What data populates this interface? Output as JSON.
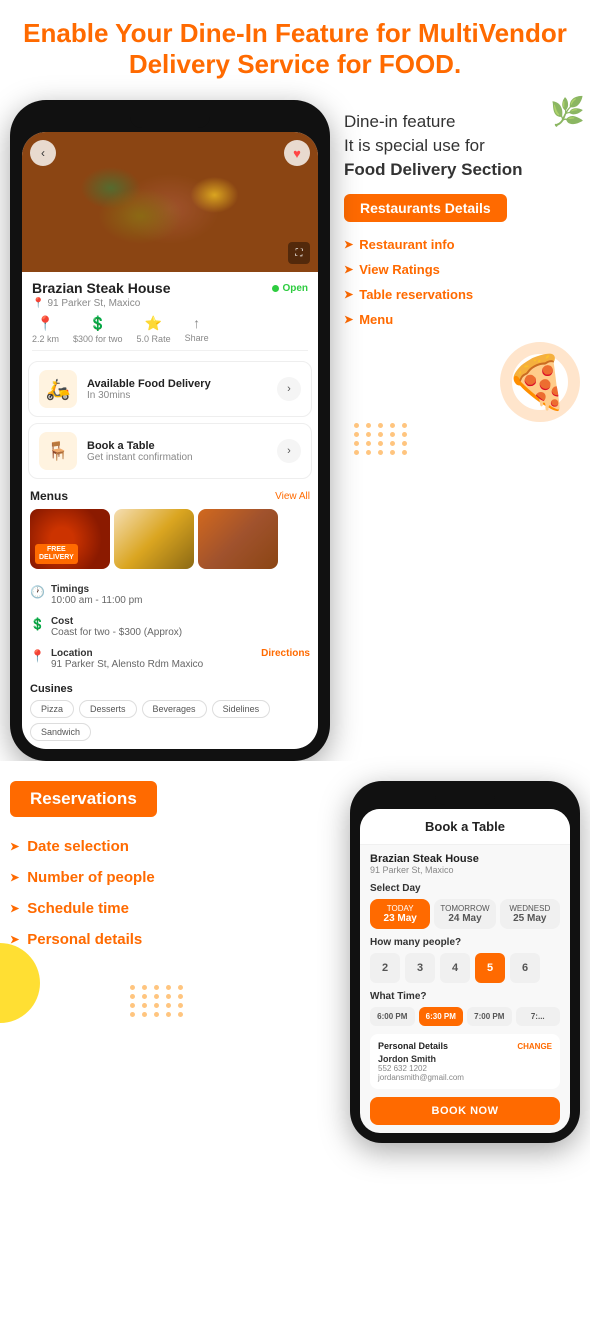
{
  "header": {
    "title": "Enable Your Dine-In Feature for MultiVendor Delivery Service for FOOD."
  },
  "dine_in_section": {
    "description_line1": "Dine-in feature",
    "description_line2": "It is special use for",
    "description_line3": "Food Delivery Section",
    "badge": "Restaurants Details",
    "features": [
      {
        "label": "Restaurant info"
      },
      {
        "label": "View Ratings"
      },
      {
        "label": "Table reservations"
      },
      {
        "label": "Menu"
      }
    ]
  },
  "phone_left": {
    "restaurant_name": "Brazian Steak House",
    "open_status": "Open",
    "address": "91 Parker St, Maxico",
    "stats": {
      "distance": "2.2 km",
      "cost": "$300 for two",
      "rate": "5.0 Rate",
      "share": "Share"
    },
    "delivery_card": {
      "title": "Available Food Delivery",
      "subtitle": "In 30mins"
    },
    "book_card": {
      "title": "Book a Table",
      "subtitle": "Get instant confirmation"
    },
    "menu": {
      "title": "Menus",
      "view_all": "View All"
    },
    "timings": {
      "label": "Timings",
      "value": "10:00 am - 11:00 pm"
    },
    "cost": {
      "label": "Cost",
      "value": "Coast for two - $300 (Approx)"
    },
    "location": {
      "label": "Location",
      "value": "91 Parker St, Alensto Rdm Maxico",
      "directions": "Directions"
    },
    "cuisines": {
      "label": "Cusines",
      "tags": [
        "Pizza",
        "Desserts",
        "Beverages",
        "Sidelines",
        "Sandwich"
      ]
    }
  },
  "reservations_section": {
    "badge": "Reservations",
    "features": [
      {
        "label": "Date selection"
      },
      {
        "label": "Number of people"
      },
      {
        "label": "Schedule time"
      },
      {
        "label": "Personal details"
      }
    ]
  },
  "phone_right": {
    "header": "Book a Table",
    "restaurant_name": "Brazian Steak House",
    "restaurant_address": "91 Parker St, Maxico",
    "select_day_label": "Select Day",
    "days": [
      {
        "label": "TODAY",
        "date": "23 May",
        "active": true
      },
      {
        "label": "TOMORROW",
        "date": "24 May",
        "active": false
      },
      {
        "label": "WEDNESD...",
        "date": "25 May",
        "active": false
      }
    ],
    "how_many_label": "How many people?",
    "people": [
      {
        "num": "2",
        "active": false
      },
      {
        "num": "3",
        "active": false
      },
      {
        "num": "4",
        "active": false
      },
      {
        "num": "5",
        "active": true
      },
      {
        "num": "6",
        "active": false
      }
    ],
    "what_time_label": "What Time?",
    "times": [
      {
        "label": "6:00 PM",
        "active": false
      },
      {
        "label": "6:30 PM",
        "active": true
      },
      {
        "label": "7:00 PM",
        "active": false
      },
      {
        "label": "7:...",
        "active": false
      }
    ],
    "personal_title": "Personal Details",
    "change_label": "CHANGE",
    "name": "Jordon Smith",
    "phone": "552 632 1202",
    "email": "jordansmith@gmail.com",
    "book_now": "BOOK NOW"
  }
}
